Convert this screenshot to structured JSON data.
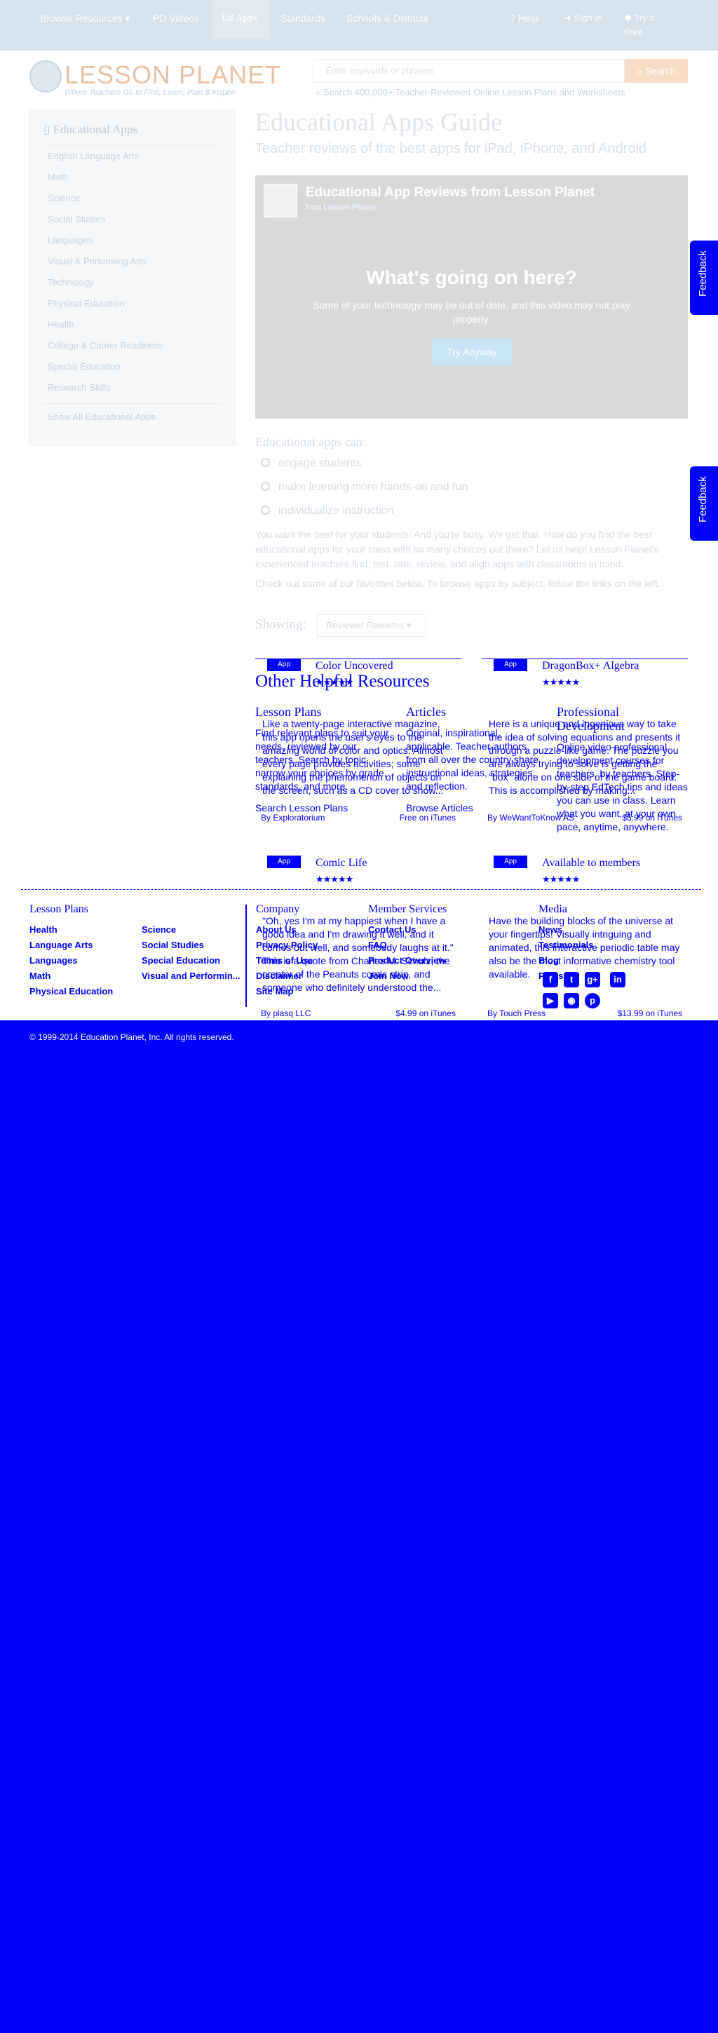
{
  "nav": {
    "items": [
      "Browse Resources",
      "PD Videos",
      "Ed Apps",
      "Standards",
      "Schools & Districts"
    ],
    "help": "Help",
    "sign_in": "Sign In",
    "try_free": "Try It Free"
  },
  "header": {
    "logo": "LESSON PLANET",
    "tagline": "Where Teachers Go to Find, Learn, Plan & Inspire",
    "search_placeholder": "Enter keywords or phrases",
    "search_button": "Search",
    "search_hint": "Search 400,000+ Teacher-Reviewed Online Lesson Plans and Worksheets"
  },
  "sidebar": {
    "title": "Educational Apps",
    "items": [
      "English Language Arts",
      "Math",
      "Science",
      "Social Studies",
      "Languages",
      "Visual & Performing Arts",
      "Technology",
      "Physical Education",
      "Health",
      "College & Career Readiness",
      "Special Education",
      "Research Skills"
    ],
    "show_all": "Show All Educational Apps"
  },
  "main": {
    "title": "Educational Apps Guide",
    "subtitle": "Teacher reviews of the best apps for iPad, iPhone, and Android",
    "video": {
      "title": "Educational App Reviews from Lesson Planet",
      "from": "from",
      "from_link": "Lesson Planet",
      "heading": "What's going on here?",
      "message": "Some of your technology may be out of date, and this video may not play properly.",
      "button": "Try Anyway"
    },
    "can_do_title": "Educational apps can:",
    "benefits": [
      "engage students",
      "make learning more hands-on and fun",
      "individualize instruction"
    ],
    "para1": "You want the best for your students. And you're busy. We get that. How do you find the best educational apps for your class with so many choices out there? Let us help! Lesson Planet's experienced teachers find, test, rate, review, and align apps with classrooms in mind.",
    "para2": "Check out some of our favorites below. To browse apps by subject, follow the links on the left.",
    "showing_label": "Showing:",
    "showing_value": "Reviewer Favorites"
  },
  "apps": [
    {
      "badge": "App",
      "title": "Color Uncovered",
      "stars": "★★★★★",
      "desc": "Like a twenty-page interactive magazine, this app opens the user's eyes to the amazing world of color and optics. Almost every page provides activities; some explaining the phenomenon of objects on the screen, such as a CD cover to show...",
      "by": "By Exploratorium",
      "price": "Free on iTunes"
    },
    {
      "badge": "App",
      "title": "DragonBox+ Algebra",
      "stars": "★★★★★",
      "desc": "Here is a unique and ingenious way to take the idea of solving equations and presents it through a puzzle-like game. The puzzle you are always trying to solve is getting the \"box\" alone on one side of the game board. This is accomplished by making...",
      "by": "By WeWantToKnow AS",
      "price": "$5.99 on iTunes"
    },
    {
      "badge": "App",
      "title": "Comic Life",
      "stars": "★★★★★",
      "desc": "\"Oh, yes I'm at my happiest when I have a good idea and I'm drawing it well, and it comes out well, and somebody laughs at it.\" This is a quote from Charles M. Schulz, the creator of the Peanuts comic strip, and someone who definitely understood the...",
      "by": "By plasq LLC",
      "price": "$4.99 on iTunes"
    },
    {
      "badge": "App",
      "title": "Available to members",
      "stars": "★★★★★",
      "desc": "Have the building blocks of the universe at your fingertips! Visually intriguing and animated, this interactive periodic table may also be the most informative chemistry tool available.",
      "by": "By Touch Press",
      "price": "$13.99 on iTunes"
    }
  ],
  "resources": {
    "title": "Other Helpful Resources",
    "cols": [
      {
        "h": "Lesson Plans",
        "p": "Find relevant plans to suit your needs, reviewed by our teachers. Search by topic, narrow your choices by grade, standards, and more.",
        "link": "Search Lesson Plans"
      },
      {
        "h": "Articles",
        "p": "Original, inspirational, applicable. Teacher-authors from all over the country share instructional ideas, strategies, and reflection.",
        "link": "Browse Articles"
      },
      {
        "h": "Professional Development",
        "p": "Online video professional development courses for teachers, by teachers. Step-by-step EdTech tips and ideas you can use in class. Learn what you want, at your own pace, anytime, anywhere.",
        "link": ""
      }
    ]
  },
  "footer": {
    "lesson_plans_title": "Lesson Plans",
    "lp_col1": [
      "Health",
      "Language Arts",
      "Languages",
      "Math",
      "Physical Education"
    ],
    "lp_col2": [
      "Science",
      "Social Studies",
      "Special Education",
      "Visual and Performin..."
    ],
    "company_title": "Company",
    "company": [
      "About Us",
      "Privacy Policy",
      "Terms of Use",
      "Disclaimer",
      "Site Map"
    ],
    "member_title": "Member Services",
    "member": [
      "Contact Us",
      "FAQ",
      "Product Overview",
      "Join Now"
    ],
    "media_title": "Media",
    "media": [
      "News",
      "Testimonials",
      "Blog",
      "Press"
    ],
    "social_icons": [
      "facebook-icon",
      "twitter-icon",
      "google-plus-icon",
      "linkedin-icon",
      "youtube-icon",
      "rss-icon",
      "pinterest-icon"
    ],
    "copyright": "© 1999-2014 Education Planet, Inc. All rights reserved."
  },
  "feedback": "Feedback"
}
